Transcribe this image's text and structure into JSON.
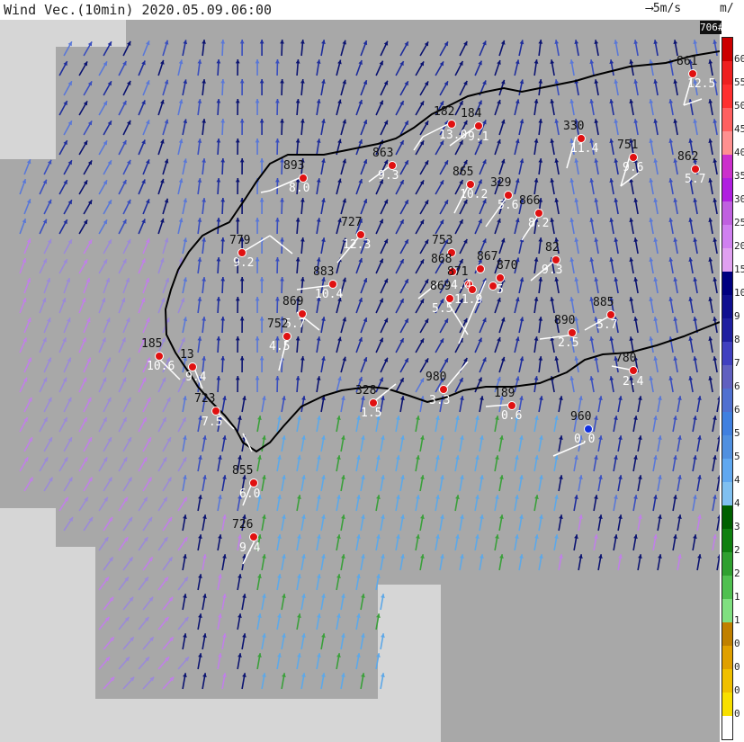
{
  "title": "Wind Vec.(10min)  2020.05.09.06:00",
  "scale_reference": "5m/s",
  "unit": "m/",
  "badge": "706#",
  "colors": {
    "land": "#a8a8a8",
    "outside": "#d6d6d6",
    "coast": "#000000",
    "barb": "#ffffff",
    "station_marker": "#e01010",
    "station_marker_alt": "#1030e0"
  },
  "colorbar": {
    "labels": [
      "60",
      "55",
      "50",
      "45",
      "40",
      "35",
      "30",
      "25",
      "20",
      "15",
      "10",
      "9",
      "8",
      "7",
      "6",
      "6",
      "5",
      "5",
      "4",
      "4",
      "3",
      "2",
      "2",
      "1",
      "1",
      "0",
      "0",
      "0",
      "0"
    ],
    "colors": [
      "#cc0000",
      "#ee2020",
      "#ff3030",
      "#ff6060",
      "#ff9090",
      "#cc30cc",
      "#b020e0",
      "#c060e0",
      "#d080f0",
      "#e0a0f0",
      "#000080",
      "#101090",
      "#2020a0",
      "#4040c0",
      "#6060c0",
      "#5070d0",
      "#4080e0",
      "#5090e0",
      "#60a8f0",
      "#80c0f0",
      "#006000",
      "#108010",
      "#30a030",
      "#50c050",
      "#80e080",
      "#c08000",
      "#e0a000",
      "#f0c000",
      "#f8e000"
    ]
  },
  "stations": [
    {
      "id": "861",
      "value": "12.5",
      "marker": "red"
    },
    {
      "id": "182",
      "value": "13.0",
      "marker": "red"
    },
    {
      "id": "184",
      "value": "9.1",
      "marker": "red"
    },
    {
      "id": "330",
      "value": "11.4",
      "marker": "red"
    },
    {
      "id": "751",
      "value": "9.6",
      "marker": "red"
    },
    {
      "id": "862",
      "value": "5.7",
      "marker": "red"
    },
    {
      "id": "893",
      "value": "8.0",
      "marker": "red"
    },
    {
      "id": "863",
      "value": "9.3",
      "marker": "red"
    },
    {
      "id": "865",
      "value": "10.2",
      "marker": "red"
    },
    {
      "id": "329",
      "value": "5.6",
      "marker": "red"
    },
    {
      "id": "866",
      "value": "8.2",
      "marker": "red"
    },
    {
      "id": "779",
      "value": "9.2",
      "marker": "red"
    },
    {
      "id": "727",
      "value": "12.3",
      "marker": "red"
    },
    {
      "id": "753",
      "value": "",
      "marker": "red"
    },
    {
      "id": "868",
      "value": "",
      "marker": "red"
    },
    {
      "id": "867",
      "value": "",
      "marker": "red"
    },
    {
      "id": "870",
      "value": "",
      "marker": "red"
    },
    {
      "id": "871",
      "value": "4.4",
      "marker": "red"
    },
    {
      "id": "82",
      "value": "9.3",
      "marker": "red"
    },
    {
      "id": "883",
      "value": "10.4",
      "marker": "red"
    },
    {
      "id": "869",
      "value": "5.5",
      "marker": "red"
    },
    {
      "id": "",
      "value": "11.9",
      "marker": "red"
    },
    {
      "id": "",
      "value": "5",
      "marker": "red"
    },
    {
      "id": "869",
      "value": "5.7",
      "marker": "red"
    },
    {
      "id": "890",
      "value": "2.5",
      "marker": "red"
    },
    {
      "id": "885",
      "value": "5.7",
      "marker": "red"
    },
    {
      "id": "752",
      "value": "4.5",
      "marker": "red"
    },
    {
      "id": "185",
      "value": "10.6",
      "marker": "red"
    },
    {
      "id": "13",
      "value": "9.4",
      "marker": "red"
    },
    {
      "id": "780",
      "value": "2.4",
      "marker": "red"
    },
    {
      "id": "980",
      "value": "3.3",
      "marker": "red"
    },
    {
      "id": "328",
      "value": "1.5",
      "marker": "red"
    },
    {
      "id": "189",
      "value": "0.6",
      "marker": "red"
    },
    {
      "id": "723",
      "value": "7.5",
      "marker": "red"
    },
    {
      "id": "960",
      "value": "0.0",
      "marker": "blue"
    },
    {
      "id": "855",
      "value": "6.0",
      "marker": "red"
    },
    {
      "id": "726",
      "value": "9.4",
      "marker": "red"
    }
  ]
}
